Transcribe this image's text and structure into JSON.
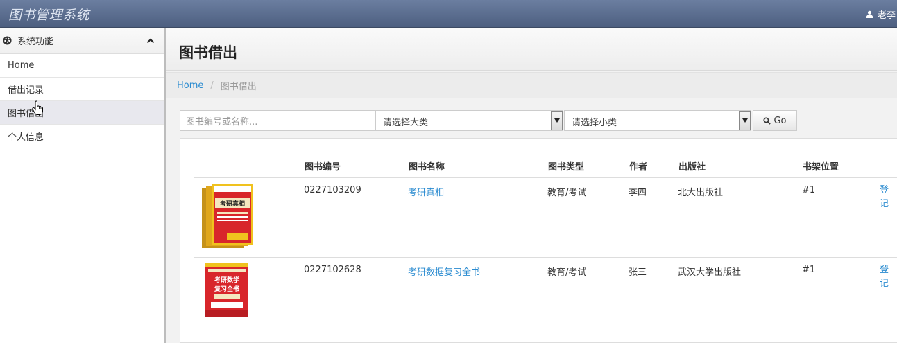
{
  "app": {
    "title": "图书管理系统",
    "user": "老李"
  },
  "sidebar": {
    "header": "系统功能",
    "items": [
      {
        "label": "Home"
      },
      {
        "label": "借出记录"
      },
      {
        "label": "图书借出"
      },
      {
        "label": "个人信息"
      }
    ]
  },
  "page": {
    "title": "图书借出"
  },
  "breadcrumb": {
    "home": "Home",
    "current": "图书借出"
  },
  "search": {
    "placeholder": "图书编号或名称...",
    "category": "请选择大类",
    "subcategory": "请选择小类",
    "go_label": "Go"
  },
  "table": {
    "headers": [
      "图书编号",
      "图书名称",
      "图书类型",
      "作者",
      "出版社",
      "书架位置"
    ],
    "action_label": "登记",
    "rows": [
      {
        "id": "0227103209",
        "name": "考研真相",
        "type": "教育/考试",
        "author": "李四",
        "publisher": "北大出版社",
        "shelf": "#1",
        "cover": "考研真相"
      },
      {
        "id": "0227102628",
        "name": "考研数据复习全书",
        "type": "教育/考试",
        "author": "张三",
        "publisher": "武汉大学出版社",
        "shelf": "#1",
        "cover": "考研数学复习全书"
      }
    ]
  },
  "colors": {
    "navbar": "#5a6c8c",
    "link": "#2a8bd0",
    "cover_red": "#d8262b",
    "cover_yellow": "#f1c21b"
  }
}
